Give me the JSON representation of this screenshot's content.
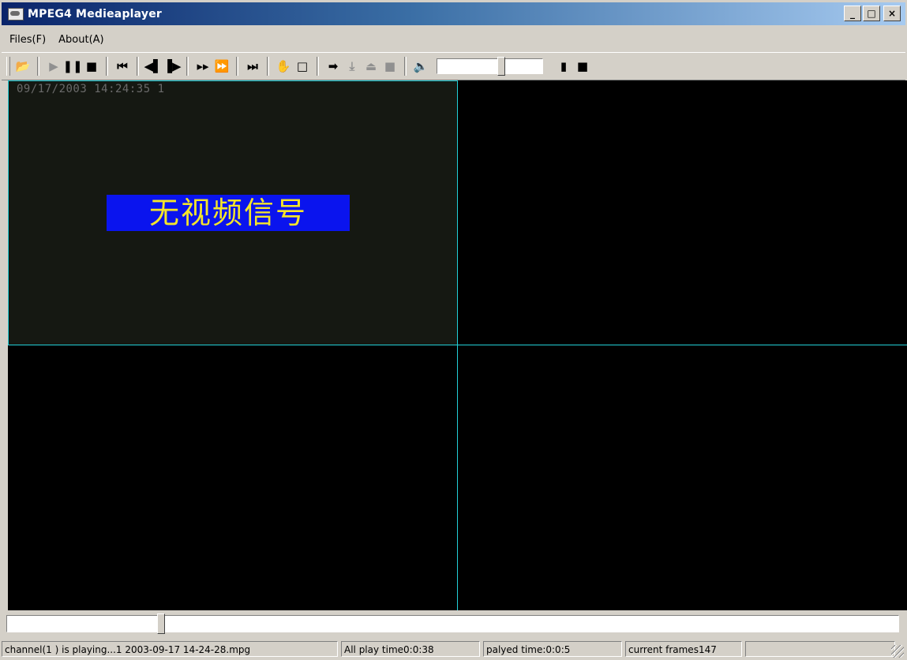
{
  "window": {
    "title": "MPEG4 Medieaplayer",
    "icon": "player-app-icon",
    "controls": {
      "minimize": "_",
      "maximize": "□",
      "close": "×"
    }
  },
  "menu": [
    "Files(F)",
    "About(A)"
  ],
  "toolbar": {
    "buttons": [
      {
        "name": "open-file-icon",
        "glyph": "📂"
      },
      {
        "name": "play-icon",
        "glyph": "▶"
      },
      {
        "name": "pause-icon",
        "glyph": "❚❚"
      },
      {
        "name": "stop-icon",
        "glyph": "■"
      },
      {
        "name": "skip-to-start-icon",
        "glyph": "⏮"
      },
      {
        "name": "step-back-icon",
        "glyph": "◀▌"
      },
      {
        "name": "step-forward-icon",
        "glyph": "▐▶"
      },
      {
        "name": "slow-play-icon",
        "glyph": "▸▸"
      },
      {
        "name": "fast-forward-icon",
        "glyph": "⏩"
      },
      {
        "name": "skip-to-end-icon",
        "glyph": "⏭"
      },
      {
        "name": "pan-hand-icon",
        "glyph": "✋"
      },
      {
        "name": "fullscreen-icon",
        "glyph": "□"
      },
      {
        "name": "arrow-right-icon",
        "glyph": "➡"
      },
      {
        "name": "download-icon",
        "glyph": "⤓"
      },
      {
        "name": "eject-icon",
        "glyph": "⏏"
      },
      {
        "name": "gray-square-icon",
        "glyph": "■"
      },
      {
        "name": "speaker-icon",
        "glyph": "🔈"
      },
      {
        "name": "mark-in-icon",
        "glyph": "▮"
      },
      {
        "name": "mark-out-icon",
        "glyph": "■"
      }
    ],
    "volume_level": 0.62
  },
  "video": {
    "osd": "09/17/2003 14:24:35   1",
    "no_signal": "无视频信号",
    "accent": "#22d0d8"
  },
  "seek": {
    "position": 0.17
  },
  "status": {
    "channel": "channel(1 ) is playing...1 2003-09-17 14-24-28.mpg",
    "total": "All play time0:0:38",
    "played": "palyed time:0:0:5",
    "frames": "current frames147"
  }
}
